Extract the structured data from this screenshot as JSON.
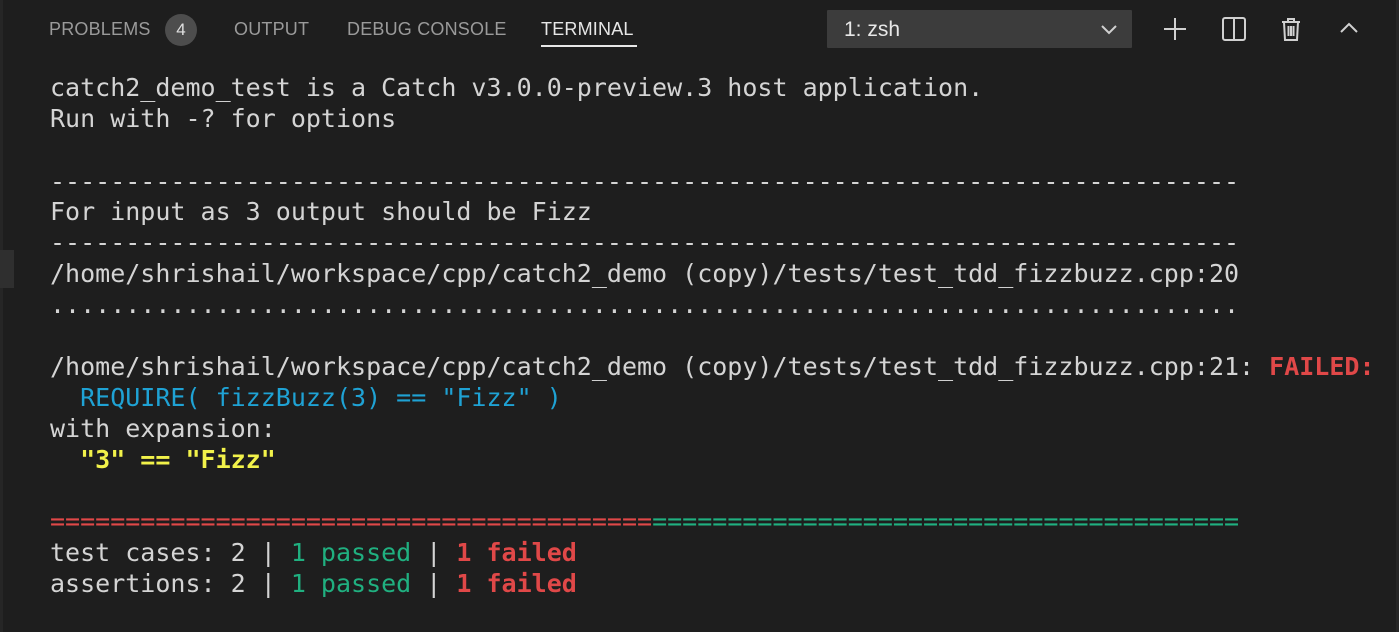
{
  "tabs": {
    "problems": "PROBLEMS",
    "problems_count": "4",
    "output": "OUTPUT",
    "debug_console": "DEBUG CONSOLE",
    "terminal": "TERMINAL"
  },
  "terminal_select": {
    "value": "1: zsh"
  },
  "icons": {
    "chevron": "chevron-down-icon",
    "add": "plus-icon",
    "split": "split-icon",
    "trash": "trash-icon",
    "maximize": "chevron-up-icon"
  },
  "colors": {
    "background": "#1e1e1e",
    "text": "#d4d4d4",
    "blue": "#1fa2d4",
    "yellow": "#f2f24a",
    "red": "#e04848",
    "green": "#20b080"
  },
  "terminal": {
    "line1": "catch2_demo_test is a Catch v3.0.0-preview.3 host application.",
    "line2": "Run with -? for options",
    "sep1": "-------------------------------------------------------------------------------",
    "test_name": "For input as 3 output should be Fizz",
    "sep2": "-------------------------------------------------------------------------------",
    "location": "/home/shrishail/workspace/cpp/catch2_demo (copy)/tests/test_tdd_fizzbuzz.cpp:20",
    "dots": "...............................................................................",
    "fail_location": "/home/shrishail/workspace/cpp/catch2_demo (copy)/tests/test_tdd_fizzbuzz.cpp:21: ",
    "failed_label": "FAILED:",
    "require_line": "  REQUIRE( fizzBuzz(3) == \"Fizz\" )",
    "with_expansion": "with expansion:",
    "expansion": "  \"3\" == \"Fizz\"",
    "summary_red": "========================================",
    "summary_green": "=======================================",
    "cases_label": "test cases: 2 | ",
    "cases_passed": "1 passed",
    "cases_sep": " | ",
    "cases_failed": "1 failed",
    "assert_label": "assertions: 2 | ",
    "assert_passed": "1 passed",
    "assert_sep": " | ",
    "assert_failed": "1 failed"
  }
}
